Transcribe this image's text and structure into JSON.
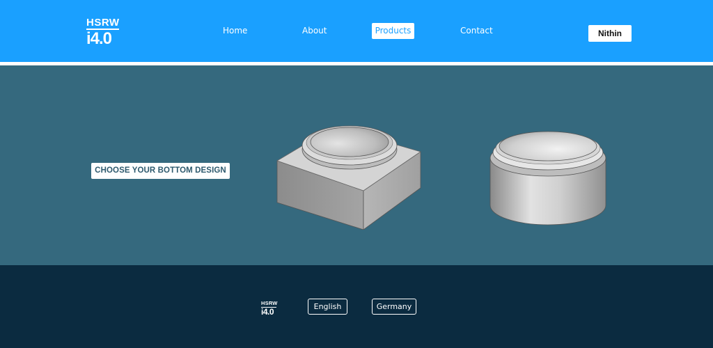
{
  "header": {
    "logo_top": "HSRW",
    "logo_bottom": "i4.0",
    "background_color": "#1aa0ff",
    "nav": {
      "home": "Home",
      "about": "About",
      "products": "Products",
      "contact": "Contact",
      "active": "products"
    },
    "user_label": "Nithin"
  },
  "main": {
    "background_color": "#35697e",
    "choose_label": "CHOOSE YOUR BOTTOM DESIGN",
    "designs": [
      {
        "shape": "square-base-with-round-cup"
      },
      {
        "shape": "cylindrical-cup"
      }
    ]
  },
  "footer": {
    "background_color": "#0b2b40",
    "logo_top": "HSRW",
    "logo_bottom": "i4.0",
    "languages": [
      "English",
      "Germany"
    ]
  }
}
